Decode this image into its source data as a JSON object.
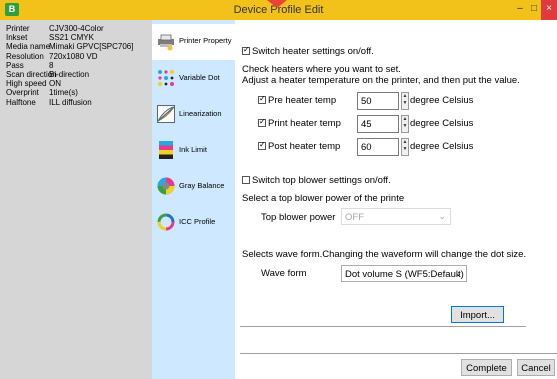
{
  "window": {
    "title": "Device Profile Edit",
    "app_icon_glyph": "B",
    "minimize_glyph": "–",
    "maximize_glyph": "□",
    "close_glyph": "×"
  },
  "info": [
    {
      "key": "Printer",
      "value": "CJV300-4Color"
    },
    {
      "key": "Inkset",
      "value": "SS21 CMYK"
    },
    {
      "key": "Media name",
      "value": "Mimaki GPVC[SPC706]"
    },
    {
      "key": "Resolution",
      "value": "720x1080 VD"
    },
    {
      "key": "Pass",
      "value": "8"
    },
    {
      "key": "Scan direction",
      "value": "Bi-direction"
    },
    {
      "key": "High speed",
      "value": "ON"
    },
    {
      "key": "Overprint",
      "value": "1time(s)"
    },
    {
      "key": "Halftone",
      "value": "ILL diffusion"
    }
  ],
  "nav": [
    {
      "label": "Printer Property",
      "icon": "printer-icon",
      "active": true
    },
    {
      "label": "Variable Dot",
      "icon": "dots-icon",
      "active": false
    },
    {
      "label": "Linearization",
      "icon": "linearization-icon",
      "active": false
    },
    {
      "label": "Ink Limit",
      "icon": "ink-limit-icon",
      "active": false
    },
    {
      "label": "Gray Balance",
      "icon": "gray-balance-icon",
      "active": false
    },
    {
      "label": "ICC Profile",
      "icon": "icc-ring-icon",
      "active": false
    }
  ],
  "heater": {
    "switch_label": "Switch heater settings on/off.",
    "switch_checked": true,
    "desc_line1": "Check heaters where you want to set.",
    "desc_line2": "Adjust a heater temperature on the printer, and then put the value.",
    "rows": [
      {
        "label": "Pre heater temp",
        "value": "50",
        "unit": "degree Celsius",
        "checked": true
      },
      {
        "label": "Print heater temp",
        "value": "45",
        "unit": "degree Celsius",
        "checked": true
      },
      {
        "label": "Post heater temp",
        "value": "60",
        "unit": "degree Celsius",
        "checked": true
      }
    ]
  },
  "blower": {
    "switch_label": "Switch top blower settings on/off.",
    "switch_checked": false,
    "desc": "Select a top blower power of the printe",
    "power_label": "Top blower power",
    "power_value": "OFF"
  },
  "wave": {
    "desc": "Selects wave form.Changing the waveform will change the dot size.",
    "label": "Wave form",
    "value": "Dot volume S (WF5:Default)"
  },
  "buttons": {
    "import": "Import...",
    "complete": "Complete",
    "cancel": "Cancel"
  },
  "colors": {
    "titlebar": "#f2c21a",
    "info_panel": "#d6d6d6",
    "nav_bg": "#cde8ff",
    "close": "#e0393e",
    "accent": "#0078d7"
  }
}
